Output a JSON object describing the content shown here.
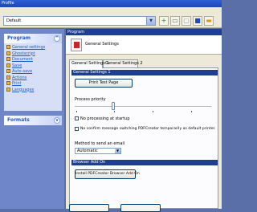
{
  "window": {
    "title": "Profile"
  },
  "profile": {
    "selected": "Default"
  },
  "toolbar": {
    "icons": [
      "add-icon",
      "rename-icon",
      "delete-icon",
      "save-icon",
      "folder-icon"
    ]
  },
  "sidebar": {
    "program_header": "Program",
    "items": [
      {
        "label": "General settings",
        "icon": "settings-icon"
      },
      {
        "label": "Ghostscript",
        "icon": "ghostscript-icon"
      },
      {
        "label": "Document",
        "icon": "document-icon"
      },
      {
        "label": "Save",
        "icon": "save-icon"
      },
      {
        "label": "Auto-save",
        "icon": "auto-save-icon"
      },
      {
        "label": "Actions",
        "icon": "actions-icon"
      },
      {
        "label": "Print",
        "icon": "print-icon"
      },
      {
        "label": "Languages",
        "icon": "languages-icon"
      }
    ],
    "formats_header": "Formats"
  },
  "main": {
    "header": "Program",
    "title": "General Settings",
    "tabs": [
      "General Settings 1",
      "General Settings 2"
    ],
    "group1": "General Settings 1",
    "print_test_page": "Print Test Page",
    "process_priority": "Process priority",
    "no_processing": "No processing at startup",
    "no_confirm": "No confirm message switching PDFCreator temporarily as default printer.",
    "email_label": "Method to send an email",
    "email_value": "Automatic",
    "group2": "Browser Add On",
    "install_button": "Install PDFCreator Browser Add On"
  },
  "colors": {
    "accent": "#1e3e96",
    "sidebar": "#6f87c8",
    "panel": "#d6dff5"
  }
}
